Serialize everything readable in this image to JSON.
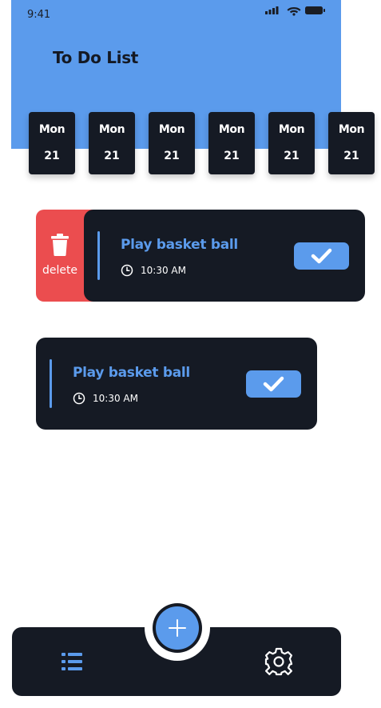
{
  "status_bar": {
    "time": "9:41"
  },
  "header": {
    "title": "To Do List",
    "color": "#5b9bec"
  },
  "date_strip": {
    "days": [
      {
        "name": "Mon",
        "date": "21"
      },
      {
        "name": "Mon",
        "date": "21"
      },
      {
        "name": "Mon",
        "date": "21"
      },
      {
        "name": "Mon",
        "date": "21"
      },
      {
        "name": "Mon",
        "date": "21"
      },
      {
        "name": "Mon",
        "date": "21"
      }
    ]
  },
  "tasks": [
    {
      "title": "Play basket ball",
      "time": "10:30 AM",
      "swiped": true,
      "delete_label": "delete",
      "icon": "check-icon"
    },
    {
      "title": "Play basket ball",
      "time": "10:30 AM",
      "swiped": false,
      "icon": "check-icon"
    }
  ],
  "bottom_nav": {
    "items": [
      {
        "icon": "list-icon"
      },
      {
        "icon": "plus-icon"
      },
      {
        "icon": "gear-icon"
      }
    ]
  },
  "colors": {
    "accent": "#5b9bec",
    "dark": "#151a24",
    "delete": "#eb4d4f"
  }
}
